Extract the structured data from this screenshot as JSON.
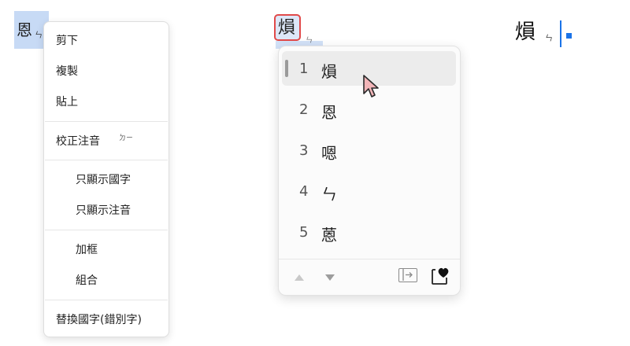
{
  "left_text": {
    "char": "恩",
    "zhuyin": "ㄣ"
  },
  "context_menu": {
    "items": [
      {
        "label": "剪下"
      },
      {
        "label": "複製"
      },
      {
        "label": "貼上"
      },
      {
        "label": "校正注音",
        "hint": "ㄉㄧ"
      },
      {
        "label": "只顯示國字"
      },
      {
        "label": "只顯示注音"
      },
      {
        "label": "加框"
      },
      {
        "label": "組合"
      },
      {
        "label": "替換國字(錯別字)"
      }
    ]
  },
  "composition": {
    "char": "熉",
    "zhuyin": "ㄣ"
  },
  "candidates": {
    "items": [
      {
        "num": "1",
        "char": "熉"
      },
      {
        "num": "2",
        "char": "恩"
      },
      {
        "num": "3",
        "char": "嗯"
      },
      {
        "num": "4",
        "char": "ㄣ"
      },
      {
        "num": "5",
        "char": "蒽"
      }
    ],
    "active_index": 1
  },
  "right_text": {
    "char": "熉",
    "zhuyin": "ㄣ"
  },
  "colors": {
    "selection": "#c7daf5",
    "composition_border": "#e14a4a",
    "caret": "#1a73e8",
    "cursor_fill": "#f2b5b8"
  }
}
